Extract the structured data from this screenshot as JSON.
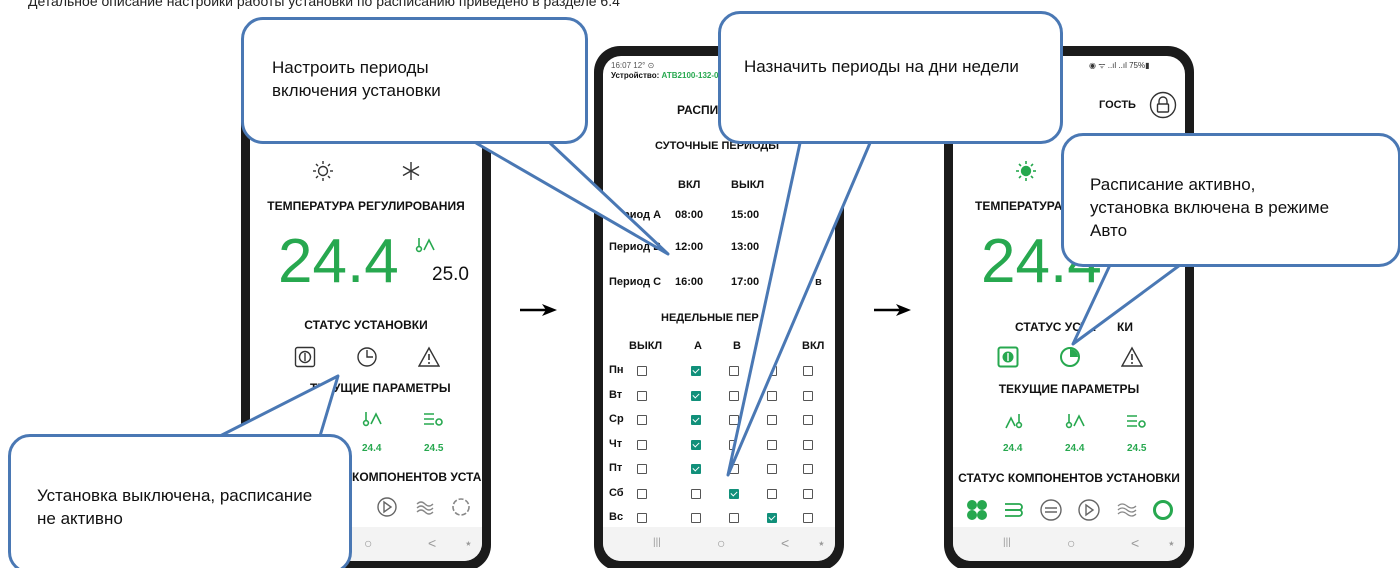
{
  "caption": "Детальное описание настройки работы установки по расписанию приведено в разделе 6.4",
  "phone1": {
    "regulation_title": "ТЕМПЕРАТУРА РЕГУЛИРОВАНИЯ",
    "main_temp": "24.4",
    "set_temp": "25.0",
    "status_title": "СТАТУС УСТАНОВКИ",
    "params_title": "ТЕКУЩИЕ ПАРАМЕТРЫ",
    "param_values": [
      "24.4",
      "24.5"
    ],
    "components_title": "КОМПОНЕНТОВ УСТАНОВКИ"
  },
  "phone2": {
    "status_time": "16:07 12° ⊙",
    "device_label": "Устройство:",
    "device_id": "АТВ2100-132-05",
    "title": "РАСПИ",
    "daily_title": "СУТОЧНЫЕ ПЕРИОДЫ",
    "col_on": "ВКЛ",
    "col_off": "ВЫКЛ",
    "periods": [
      {
        "name": "Период А",
        "on": "08:00",
        "off": "15:00",
        "extra": ""
      },
      {
        "name": "Период В",
        "on": "12:00",
        "off": "13:00",
        "extra": "в"
      },
      {
        "name": "Период С",
        "on": "16:00",
        "off": "17:00",
        "extra": "в"
      }
    ],
    "weekly_title": "НЕДЕЛЬНЫЕ ПЕР",
    "week_cols": [
      "ВЫКЛ",
      "А",
      "В",
      "С",
      "ВКЛ"
    ],
    "days": [
      "Пн",
      "Вт",
      "Ср",
      "Чт",
      "Пт",
      "Сб",
      "Вс"
    ],
    "checked": [
      [
        false,
        true,
        false,
        false,
        false
      ],
      [
        false,
        true,
        false,
        false,
        false
      ],
      [
        false,
        true,
        false,
        false,
        false
      ],
      [
        false,
        true,
        false,
        false,
        false
      ],
      [
        false,
        true,
        false,
        false,
        false
      ],
      [
        false,
        false,
        true,
        false,
        false
      ],
      [
        false,
        false,
        false,
        true,
        false
      ]
    ]
  },
  "phone3": {
    "status_bar": "◉ ᯤ ..ıl ..ıl 75%▮",
    "user_label": "ГОСТЬ",
    "regulation_title": "ТЕМПЕРАТУРА",
    "main_temp": "24.4",
    "status_title": "СТАТУС УСТА",
    "status_title_tail": "КИ",
    "params_title": "ТЕКУЩИЕ ПАРАМЕТРЫ",
    "param_values": [
      "24.4",
      "24.4",
      "24.5"
    ],
    "components_title": "СТАТУС КОМПОНЕНТОВ УСТАНОВКИ"
  },
  "callouts": {
    "periods": "Настроить периоды включения установки",
    "days": "Назначить периоды на дни недели",
    "active": "Расписание активно, установка включена в режиме Авто",
    "off": "Установка выключена, расписание не активно"
  },
  "nav": {
    "recent": "|||",
    "home": "○",
    "back": "<",
    "extra": "⋆"
  },
  "colors": {
    "accent_green": "#27a84f",
    "callout_border": "#4a78b4",
    "checkbox_on": "#11907a"
  }
}
